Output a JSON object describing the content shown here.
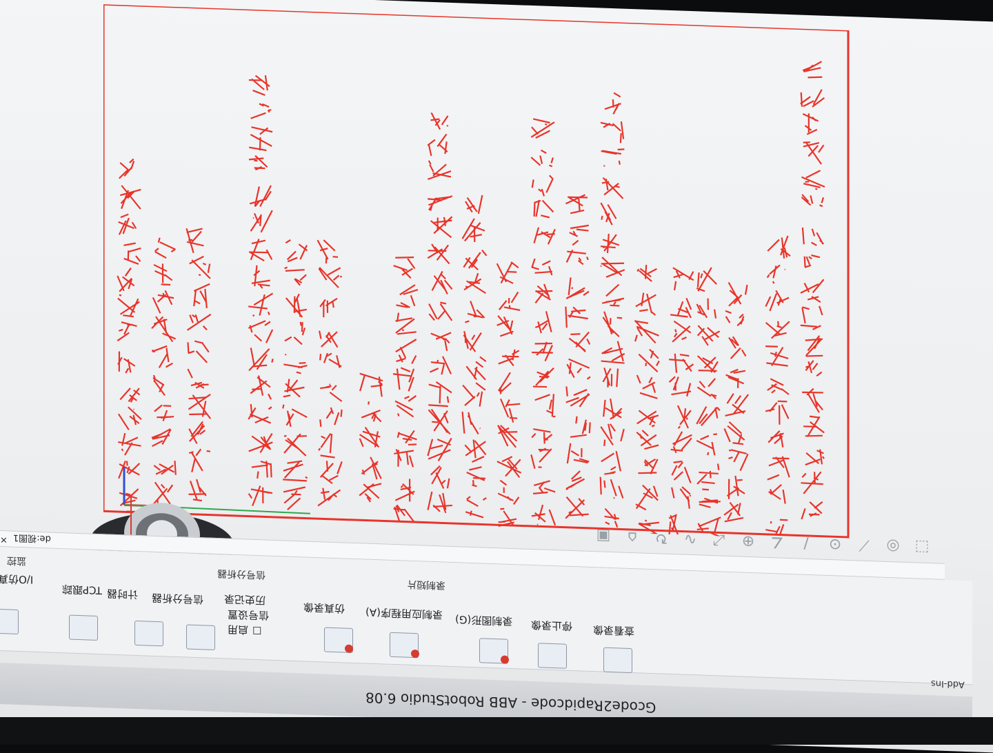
{
  "window": {
    "title": "Gcode2Rapidcode - ABB RobotStudio 6.08",
    "tab_label": "Add-Ins"
  },
  "document_tab": {
    "label": "de:视图1",
    "close_glyph": "×"
  },
  "ribbon": {
    "left_column": [
      "I/O仿真器",
      "TCP跟踪",
      "计时器",
      "信号分析器"
    ],
    "left_group_label": "监控",
    "signal_group": {
      "items": [
        "启用",
        "信号设置",
        "历史记录"
      ],
      "label": "信号分析器"
    },
    "record_group": {
      "buttons": [
        "仿真录像",
        "录制应用程序(A)",
        "录制图形(G)",
        "停止录像",
        "查看录像"
      ],
      "label": "录制短片"
    }
  },
  "view_toolbar": {
    "icons": [
      "select-icon",
      "snap-icon",
      "measure-icon",
      "point-icon",
      "line-icon",
      "angle-icon",
      "center-icon",
      "distance-icon",
      "freehand-icon",
      "rotate-icon",
      "home-icon",
      "camera-icon"
    ]
  },
  "colors": {
    "stroke": "#e8342a",
    "tool_body": "#2a2b2e",
    "axis_x": "#d63b2f",
    "axis_y": "#2fa84a",
    "axis_z": "#2f4fd6"
  }
}
